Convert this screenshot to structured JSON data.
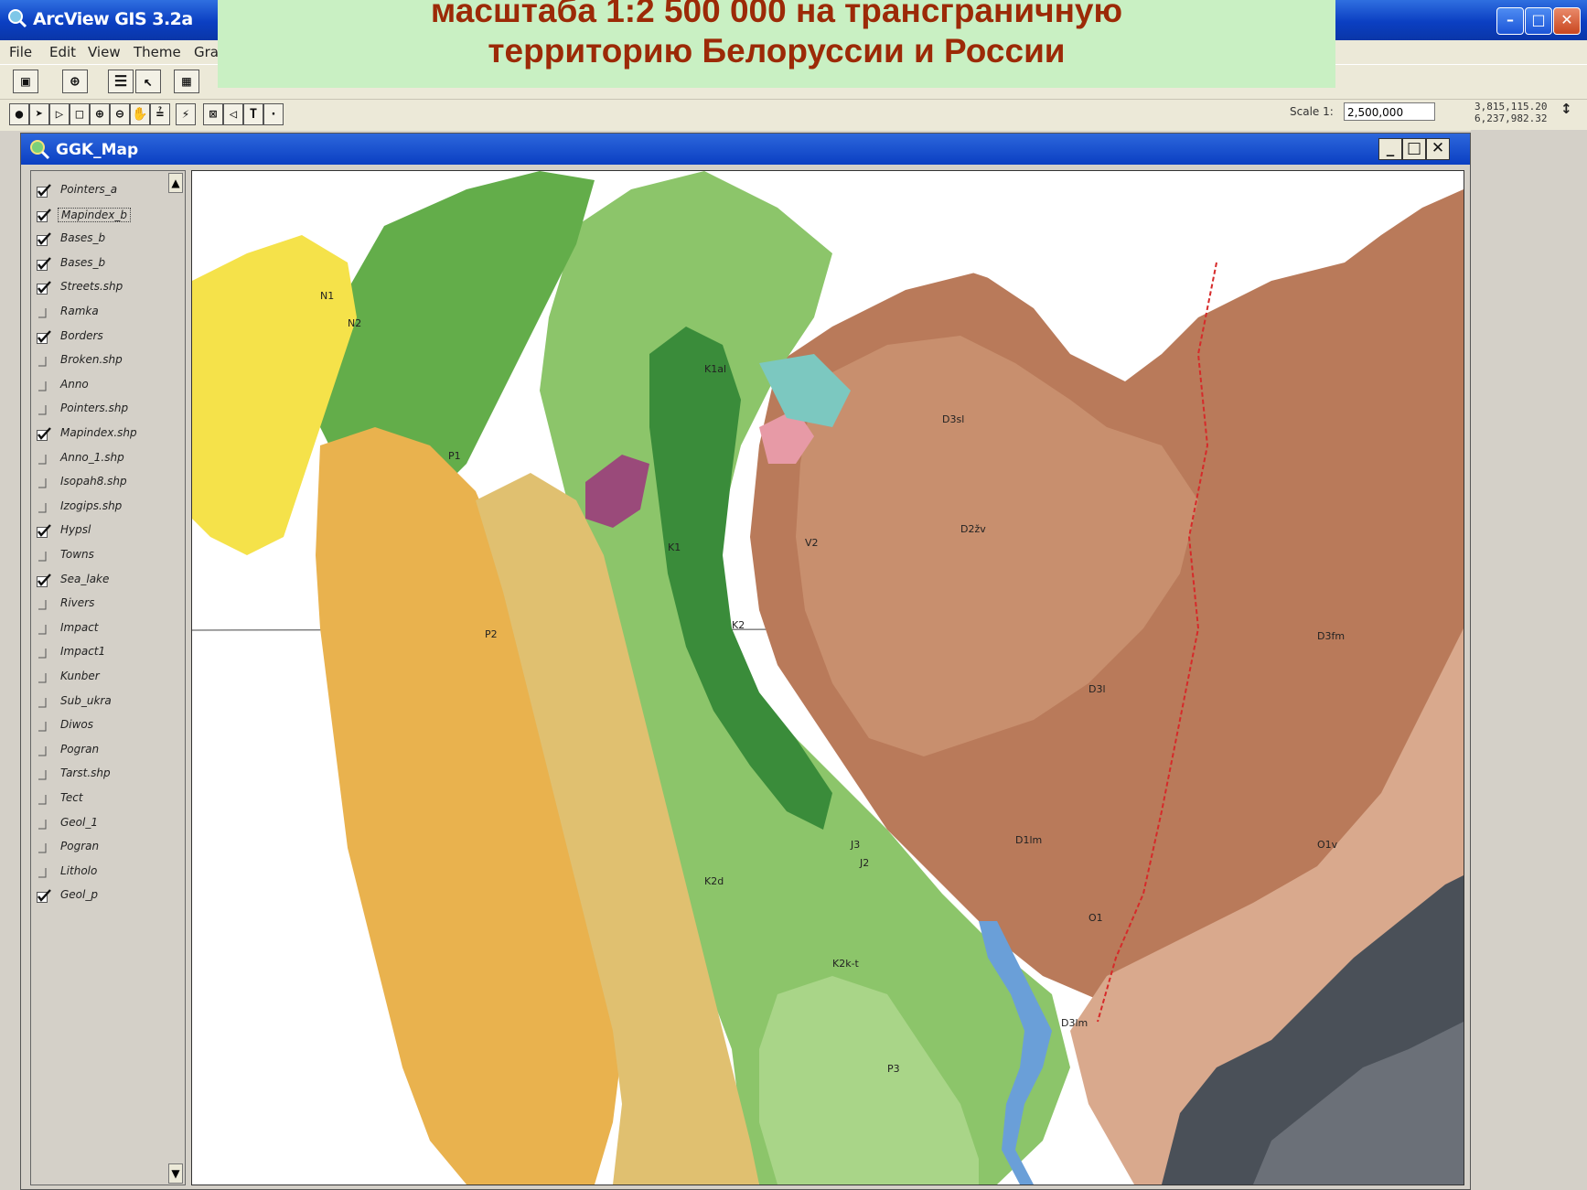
{
  "app": {
    "title": "ArcView GIS 3.2a",
    "window_buttons": {
      "minimize": "–",
      "maximize": "□",
      "close": "✕"
    }
  },
  "slide_caption": {
    "line1": "масштаба 1:2 500 000 на трансграничную",
    "line2": "территорию Белоруссии и России",
    "color": "#9c2a07",
    "background": "#c9f0c3"
  },
  "menu": [
    "File",
    "Edit",
    "View",
    "Theme",
    "Gra"
  ],
  "toolbar": {
    "scale_label": "Scale 1:",
    "scale_value": "2,500,000",
    "coord_x": "3,815,115.20",
    "coord_y": "6,237,982.32",
    "coord_arrows": "↕"
  },
  "view": {
    "title": "GGK_Map",
    "buttons": {
      "minimize": "_",
      "maximize": "□",
      "close": "✕"
    }
  },
  "toc": {
    "layers": [
      {
        "name": "Pointers_a",
        "checked": true
      },
      {
        "name": "Mapindex_b",
        "checked": true
      },
      {
        "name": "Bases_b",
        "checked": true
      },
      {
        "name": "Bases_b",
        "checked": true
      },
      {
        "name": "Streets.shp",
        "checked": true
      },
      {
        "name": "Ramka",
        "checked": false
      },
      {
        "name": "Borders",
        "checked": true
      },
      {
        "name": "Broken.shp",
        "checked": false
      },
      {
        "name": "Anno",
        "checked": false
      },
      {
        "name": "Pointers.shp",
        "checked": false
      },
      {
        "name": "Mapindex.shp",
        "checked": true
      },
      {
        "name": "Anno_1.shp",
        "checked": false
      },
      {
        "name": "Isopah8.shp",
        "checked": false
      },
      {
        "name": "Izogips.shp",
        "checked": false
      },
      {
        "name": "Hypsl",
        "checked": true
      },
      {
        "name": "Towns",
        "checked": false
      },
      {
        "name": "Sea_lake",
        "checked": true
      },
      {
        "name": "Rivers",
        "checked": false
      },
      {
        "name": "Impact",
        "checked": false
      },
      {
        "name": "Impact1",
        "checked": false
      },
      {
        "name": "Kunber",
        "checked": false
      },
      {
        "name": "Sub_ukra",
        "checked": false
      },
      {
        "name": "Diwos",
        "checked": false
      },
      {
        "name": "Pogran",
        "checked": false
      },
      {
        "name": "Tarst.shp",
        "checked": false
      },
      {
        "name": "Tect",
        "checked": false
      },
      {
        "name": "Geol_1",
        "checked": false
      },
      {
        "name": "Pogran",
        "checked": false
      },
      {
        "name": "Litholo",
        "checked": false
      },
      {
        "name": "Geol_p",
        "checked": true
      }
    ],
    "selected_index": 1,
    "scroll_up": "▲",
    "scroll_down": "▼"
  },
  "map": {
    "colors": {
      "brown_dark": "#b97a5a",
      "brown_mid": "#c88f6e",
      "brown_light": "#d9a98d",
      "green_dark": "#3a8c3a",
      "green_mid": "#63ad4a",
      "green_light": "#8cc56a",
      "green_pale": "#a9d588",
      "yellow": "#f5e24a",
      "orange": "#e9b24e",
      "tan": "#e0c070",
      "gray_dark": "#4a5058",
      "gray_mid": "#6b7078",
      "blue": "#6a9fd8",
      "pink": "#e79aa6",
      "purple": "#9a4a7a",
      "teal": "#7cc8c0"
    },
    "labels": [
      "D3fm",
      "D3l",
      "D2žv",
      "D3sl",
      "K1",
      "K2",
      "K1al",
      "P1",
      "P2",
      "N1",
      "J3",
      "O1",
      "V2",
      "K2d",
      "D1lm",
      "O1v",
      "N2",
      "K2k-t",
      "J2",
      "P3",
      "D3lm"
    ]
  }
}
